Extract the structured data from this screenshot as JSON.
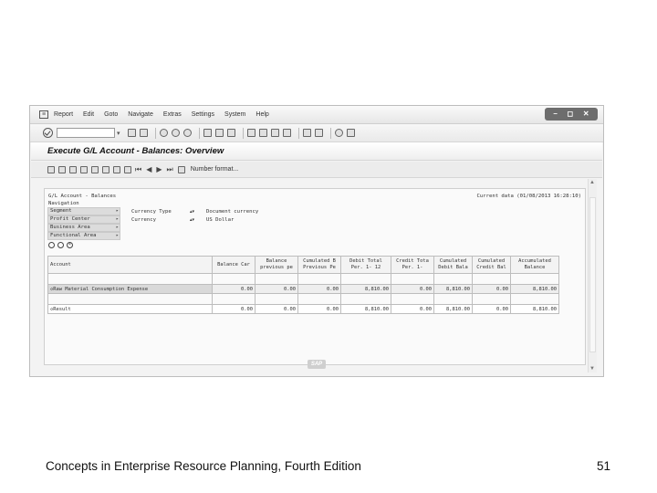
{
  "menubar": {
    "items": [
      "Report",
      "Edit",
      "Goto",
      "Navigate",
      "Extras",
      "Settings",
      "System",
      "Help"
    ]
  },
  "window_controls": [
    "–",
    "◻",
    "✕"
  ],
  "toolbar": {
    "command_value": ""
  },
  "title": "Execute G/L Account - Balances: Overview",
  "app_toolbar": {
    "nav": [
      "⏮",
      "◀",
      "▶",
      "⏭"
    ],
    "format_label": "Number format..."
  },
  "report": {
    "title": "G/L Account - Balances",
    "current_data": "Current data (01/08/2013 16:28:10)",
    "navigation_label": "Navigation",
    "nav_items": [
      "Segment",
      "Profit Center",
      "Business Area",
      "Functional Area"
    ],
    "selections": [
      {
        "label": "Currency Type",
        "value": "Document currency"
      },
      {
        "label": "Currency",
        "value": "US Dollar"
      }
    ]
  },
  "table": {
    "headers": [
      "Account",
      "Balance Car",
      "Balance\nprevious pe",
      "Cumulated B\nPrevious Pe",
      "Debit Total\nPer.   1-  12",
      "Credit Tota\nPer.   1-",
      "Cumulated\nDebit Bala",
      "Cumulated\nCredit Bal",
      "Accumulated\nBalance"
    ],
    "rows": [
      [
        "Raw Material Consumption Expense",
        "0.00",
        "0.00",
        "0.00",
        "8,810.00",
        "0.00",
        "8,810.00",
        "0.00",
        "8,810.00"
      ],
      [
        "Result",
        "0.00",
        "0.00",
        "0.00",
        "8,810.00",
        "0.00",
        "8,810.00",
        "0.00",
        "8,810.00"
      ]
    ]
  },
  "sap_logo": "SAP",
  "footer": {
    "text": "Concepts in Enterprise Resource Planning, Fourth Edition",
    "page": "51"
  }
}
